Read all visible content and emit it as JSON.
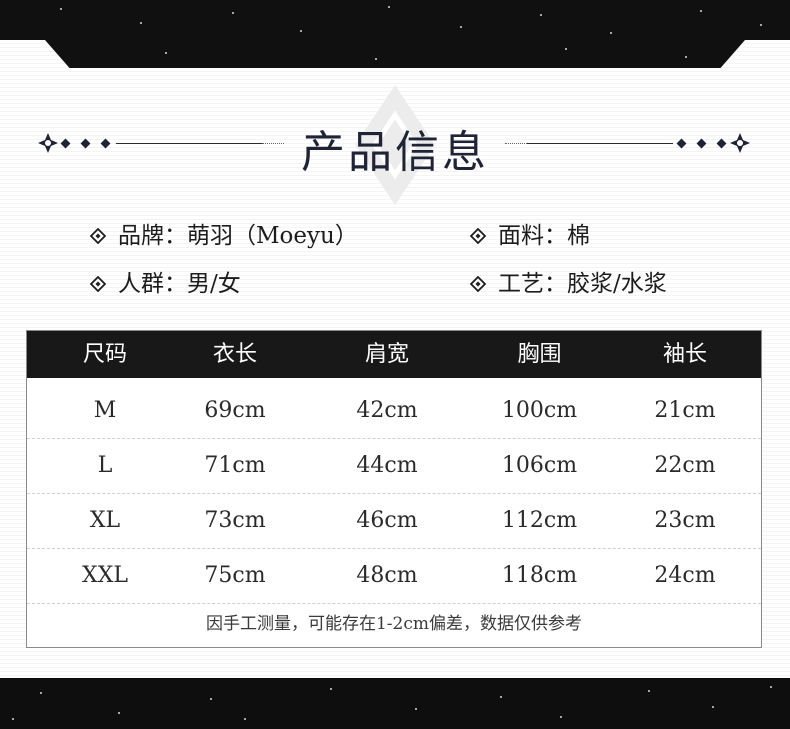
{
  "title": "产品信息",
  "info": [
    {
      "label": "品牌",
      "sep": "：",
      "value": "萌羽（Moeyu）"
    },
    {
      "label": "面料",
      "sep": "：",
      "value": "棉"
    },
    {
      "label": "人群",
      "sep": "：",
      "value": "男/女"
    },
    {
      "label": "工艺",
      "sep": "：",
      "value": "胶浆/水浆"
    }
  ],
  "table": {
    "headers": [
      "尺码",
      "衣长",
      "肩宽",
      "胸围",
      "袖长"
    ],
    "rows": [
      [
        "M",
        "69cm",
        "42cm",
        "100cm",
        "21cm"
      ],
      [
        "L",
        "71cm",
        "44cm",
        "106cm",
        "22cm"
      ],
      [
        "XL",
        "73cm",
        "46cm",
        "112cm",
        "23cm"
      ],
      [
        "XXL",
        "75cm",
        "48cm",
        "118cm",
        "24cm"
      ]
    ],
    "note": "因手工测量，可能存在1-2cm偏差，数据仅供参考"
  },
  "colors": {
    "band": "#101010",
    "title": "#1f2336",
    "header_bg": "#181818"
  },
  "icons": [
    "snowflake-ornament-icon",
    "diamond-bullet-icon"
  ]
}
